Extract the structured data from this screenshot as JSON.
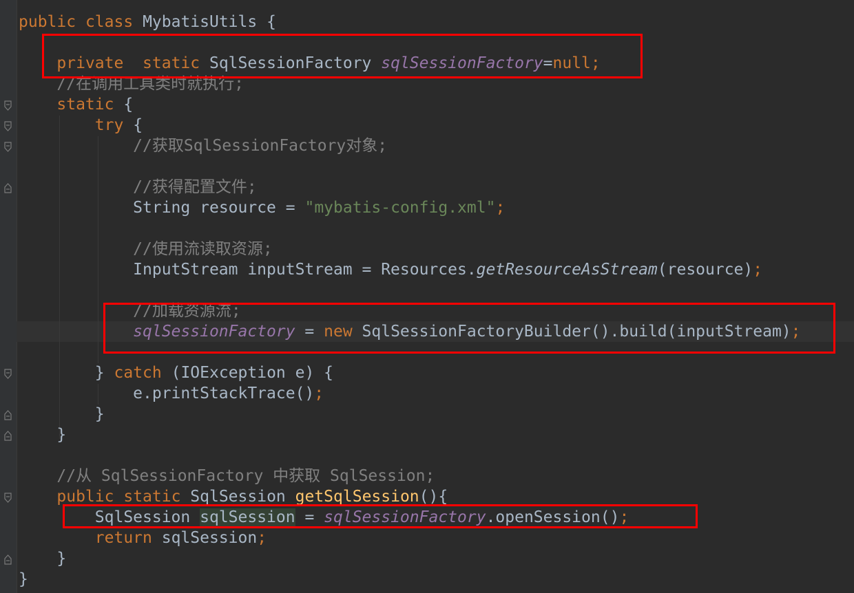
{
  "code": {
    "l1": {
      "kw1": "public",
      "kw2": "class",
      "name": "MybatisUtils",
      "brace": "{"
    },
    "l3": {
      "kw1": "private",
      "kw2": "static",
      "type": "SqlSessionFactory",
      "field": "sqlSessionFactory",
      "eq": "=",
      "null": "null",
      "semi": ";"
    },
    "l4": {
      "comment": "//在调用工具类时就执行;"
    },
    "l5": {
      "kw": "static",
      "brace": "{"
    },
    "l6": {
      "kw": "try",
      "brace": "{"
    },
    "l7": {
      "comment": "//获取SqlSessionFactory对象;"
    },
    "l9": {
      "comment": "//获得配置文件;"
    },
    "l10": {
      "type": "String",
      "var": "resource",
      "eq": "=",
      "str": "\"mybatis-config.xml\"",
      "semi": ";"
    },
    "l12": {
      "comment": "//使用流读取资源;"
    },
    "l13": {
      "pre": "InputStream inputStream = Resources.",
      "method": "getResourceAsStream",
      "post": "(resource)",
      "semi": ";"
    },
    "l15": {
      "comment": "//加载资源流;"
    },
    "l16": {
      "field": "sqlSessionFactory",
      "eq": " = ",
      "kw": "new",
      "post": "SqlSessionFactoryBuilder().build(inputStream)",
      "semi": ";"
    },
    "l18": {
      "close": "}",
      "kw": "catch",
      "post": "(IOException e) {"
    },
    "l19": {
      "pre": "e.printStackTrace()",
      "semi": ";"
    },
    "l20": {
      "close": "}"
    },
    "l21": {
      "close": "}"
    },
    "l23": {
      "comment": "//从 SqlSessionFactory 中获取 SqlSession;"
    },
    "l24": {
      "kw1": "public",
      "kw2": "static",
      "type": "SqlSession",
      "method": "getSqlSession",
      "post": "(){"
    },
    "l25": {
      "type": "SqlSession",
      "var": "sqlSession",
      "eq": " = ",
      "field": "sqlSessionFactory",
      "post": ".openSession()",
      "semi": ";"
    },
    "l26": {
      "kw": "return",
      "var": "sqlSession",
      "semi": ";"
    },
    "l27": {
      "close": "}"
    },
    "l28": {
      "close": "}"
    }
  },
  "colors": {
    "background": "#2b2b2b",
    "keyword": "#cc7832",
    "field": "#9876aa",
    "string": "#6a8759",
    "comment": "#808080",
    "method": "#ffc66d",
    "text": "#a9b7c6",
    "annotation_box": "#ff0000"
  }
}
